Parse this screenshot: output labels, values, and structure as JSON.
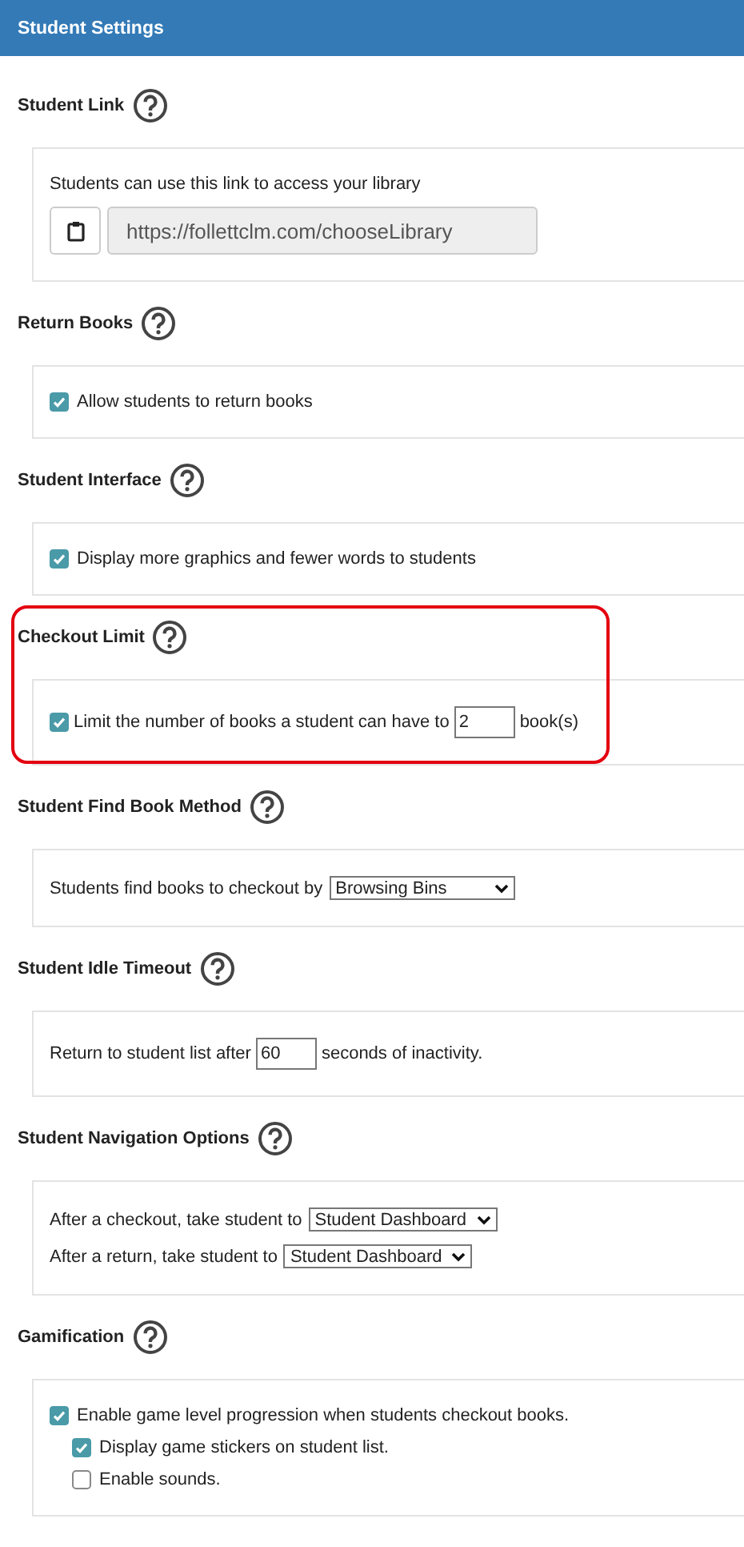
{
  "header": {
    "title": "Student Settings"
  },
  "sections": [
    {
      "title": "Student Link",
      "highlighted": false,
      "rows": [
        {
          "kind": "text",
          "label": "Students can use this link to access your library"
        },
        {
          "kind": "link",
          "value": "https://follettclm.com/chooseLibrary"
        }
      ]
    },
    {
      "title": "Return Books",
      "highlighted": false,
      "rows": [
        {
          "kind": "checkbox",
          "label": "Allow students to return books",
          "checked": true
        }
      ]
    },
    {
      "title": "Student Interface",
      "highlighted": false,
      "rows": [
        {
          "kind": "checkbox",
          "label": "Display more graphics and fewer words to students",
          "checked": true
        }
      ]
    },
    {
      "title": "Checkout Limit",
      "highlighted": true,
      "rows": [
        {
          "kind": "checkbox-number",
          "label": "Limit the number of books a student can have to",
          "checked": true,
          "value": "2",
          "suffix": "book(s)"
        }
      ]
    },
    {
      "title": "Student Find Book Method",
      "highlighted": false,
      "rows": [
        {
          "kind": "select",
          "label": "Students find books to checkout by",
          "value": "Browsing Bins"
        }
      ]
    },
    {
      "title": "Student Idle Timeout",
      "highlighted": false,
      "rows": [
        {
          "kind": "number",
          "label": "Return to student list after",
          "value": "60",
          "suffix": "seconds of inactivity."
        }
      ]
    },
    {
      "title": "Student Navigation Options",
      "highlighted": false,
      "rows": [
        {
          "kind": "select",
          "label": "After a checkout, take student to",
          "value": "Student Dashboard"
        },
        {
          "kind": "select",
          "label": "After a return, take student to",
          "value": "Student Dashboard"
        }
      ]
    },
    {
      "title": "Gamification",
      "highlighted": false,
      "rows": [
        {
          "kind": "checkbox",
          "label": "Enable game level progression when students checkout books.",
          "checked": true,
          "children": [
            {
              "kind": "checkbox",
              "label": "Display game stickers on student list.",
              "checked": true
            },
            {
              "kind": "checkbox",
              "label": "Enable sounds.",
              "checked": false
            }
          ]
        }
      ]
    }
  ]
}
